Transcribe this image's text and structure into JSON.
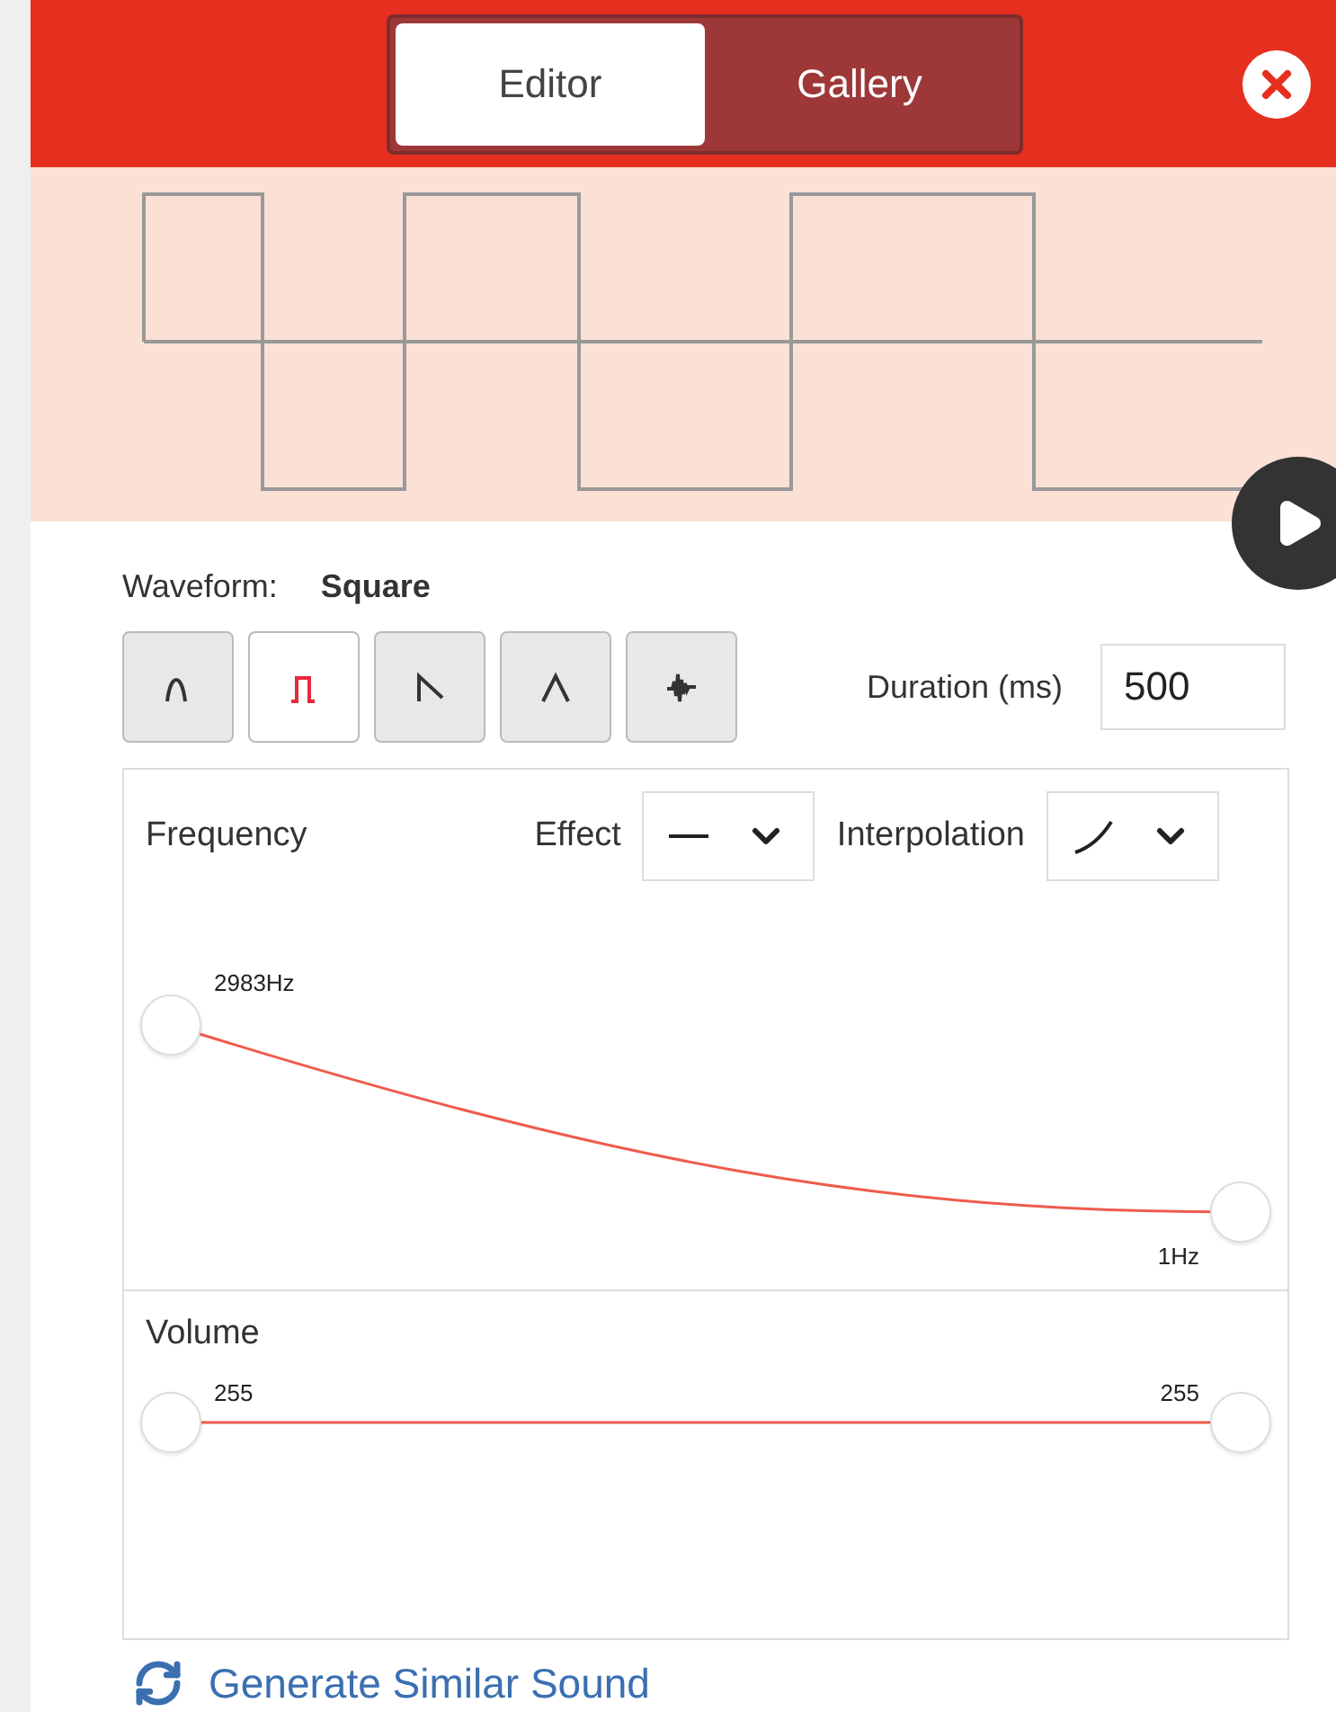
{
  "tabs": [
    {
      "label": "Editor",
      "selected": true
    },
    {
      "label": "Gallery",
      "selected": false
    }
  ],
  "waveform": {
    "label": "Waveform:",
    "value": "Square"
  },
  "waveform_buttons": [
    {
      "kind": "sine",
      "selected": false
    },
    {
      "kind": "square",
      "selected": true
    },
    {
      "kind": "sawtooth",
      "selected": false
    },
    {
      "kind": "triangle",
      "selected": false
    },
    {
      "kind": "noise",
      "selected": false
    }
  ],
  "duration": {
    "label": "Duration (ms)",
    "value": "500"
  },
  "frequency": {
    "label": "Frequency",
    "effect_label": "Effect",
    "interpolation_label": "Interpolation",
    "start": {
      "reading": "2983Hz"
    },
    "end": {
      "reading": "1Hz"
    }
  },
  "volume": {
    "label": "Volume",
    "start": {
      "reading": "255"
    },
    "end": {
      "reading": "255"
    }
  },
  "generate_link": "Generate Similar Sound"
}
